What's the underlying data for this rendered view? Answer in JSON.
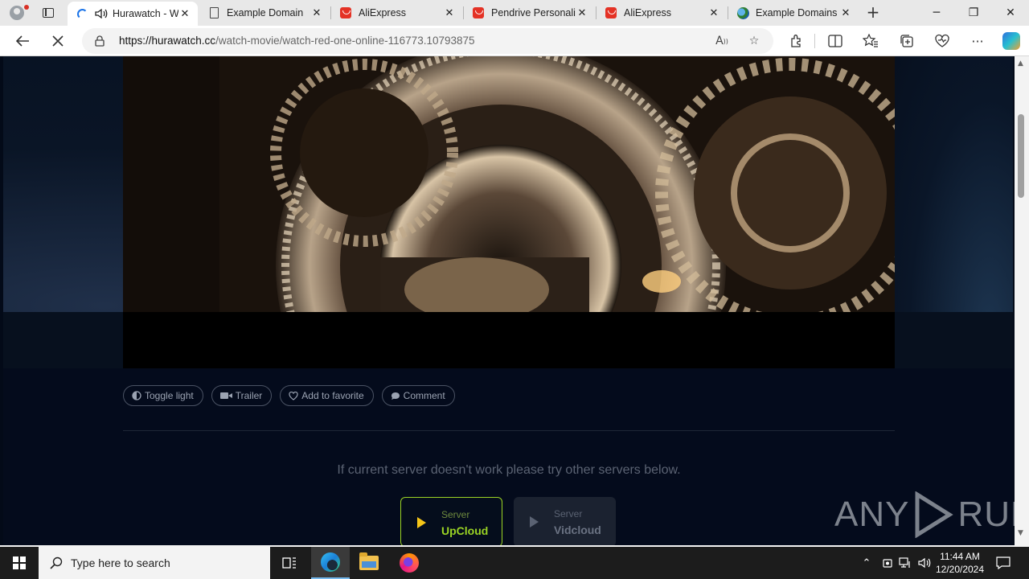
{
  "browser": {
    "tabs": [
      {
        "title": "Hurawatch - W",
        "favicon": "loading-spinner-icon",
        "audio": true,
        "active": true
      },
      {
        "title": "Example Domain",
        "favicon": "page-icon",
        "active": false
      },
      {
        "title": "AliExpress",
        "favicon": "aliexpress-icon",
        "active": false
      },
      {
        "title": "Pendrive Personaliz",
        "favicon": "aliexpress-icon",
        "active": false
      },
      {
        "title": "AliExpress",
        "favicon": "aliexpress-icon",
        "active": false
      },
      {
        "title": "Example Domains",
        "favicon": "globe-icon",
        "active": false
      }
    ],
    "url_host": "https://hurawatch.cc",
    "url_path": "/watch-movie/watch-red-one-online-116773.10793875",
    "window_controls": {
      "minimize": "─",
      "restore": "❐",
      "close": "✕"
    }
  },
  "page": {
    "actions": [
      {
        "label": "Toggle light",
        "icon": "half-circle-icon"
      },
      {
        "label": "Trailer",
        "icon": "video-camera-icon"
      },
      {
        "label": "Add to favorite",
        "icon": "heart-icon"
      },
      {
        "label": "Comment",
        "icon": "comment-icon"
      }
    ],
    "server_notice": "If current server doesn't work please try other servers below.",
    "servers": [
      {
        "label": "Server",
        "name": "UpCloud",
        "selected": true
      },
      {
        "label": "Server",
        "name": "Vidcloud",
        "selected": false
      }
    ],
    "watermark": {
      "left": "ANY",
      "right": "RUN"
    }
  },
  "colors": {
    "accent_green": "#9bd424",
    "play_yellow": "#f5c518",
    "page_background": "#040b1c"
  },
  "taskbar": {
    "search_placeholder": "Type here to search",
    "time": "11:44 AM",
    "date": "12/20/2024"
  }
}
